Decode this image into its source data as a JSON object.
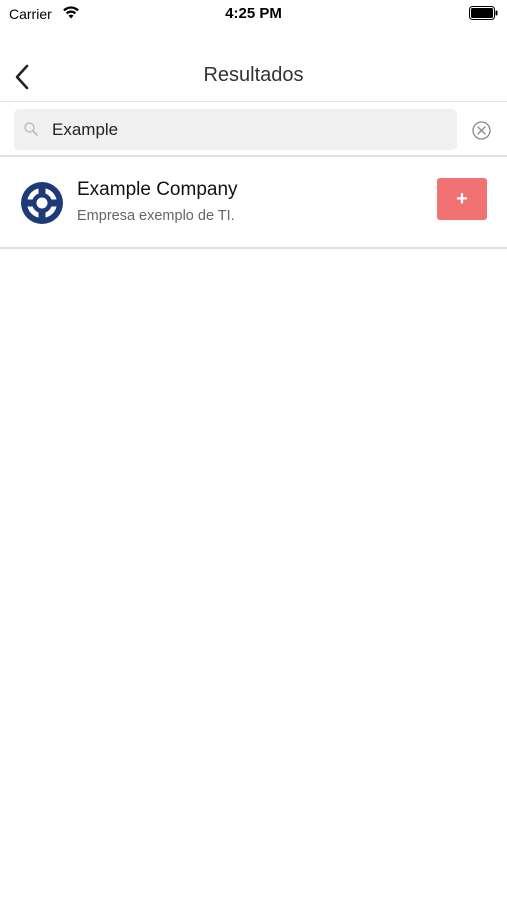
{
  "status_bar": {
    "carrier": "Carrier",
    "time": "4:25 PM",
    "icons": [
      "wifi-icon",
      "battery-icon"
    ]
  },
  "nav": {
    "title": "Resultados",
    "back_icon": "chevron-left-icon"
  },
  "search": {
    "value": "Example",
    "icon": "search-icon",
    "clear_icon": "clear-circle-icon"
  },
  "results": [
    {
      "title": "Example Company",
      "subtitle": "Empresa exemplo de TI.",
      "avatar_icon": "lifebuoy-icon",
      "action_label": "+"
    }
  ],
  "colors": {
    "accent": "#f07272",
    "avatar": "#1e3a78"
  }
}
